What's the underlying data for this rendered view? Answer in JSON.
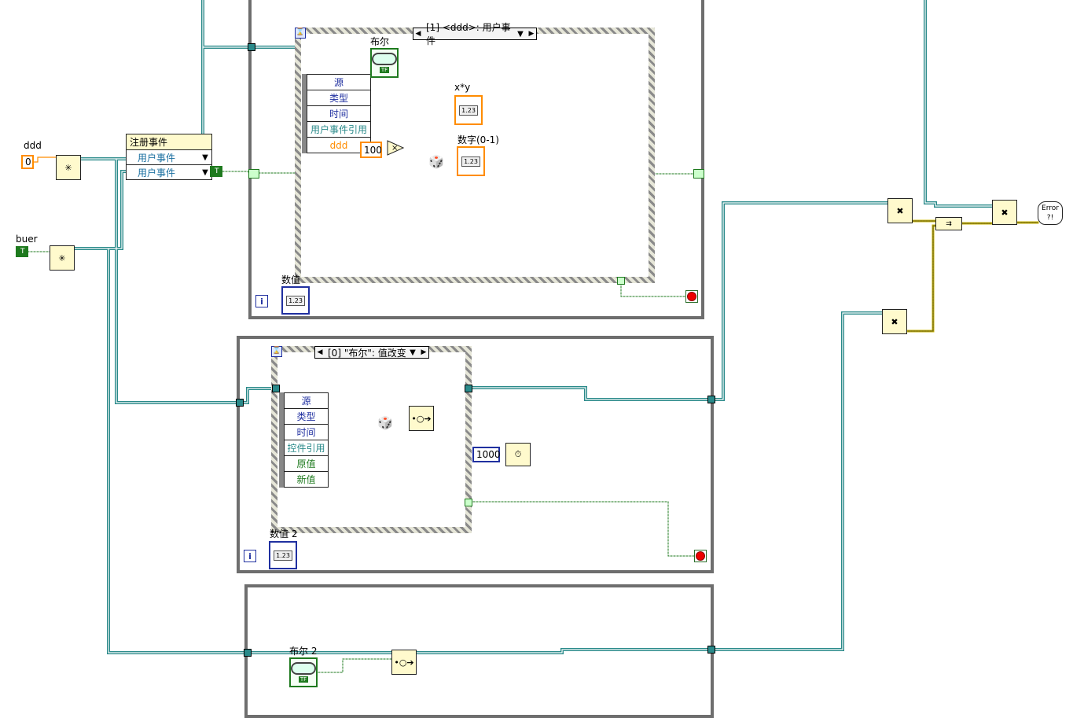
{
  "labels": {
    "ddd": "ddd",
    "buer": "buer",
    "bool": "布尔",
    "xy": "x*y",
    "num01": "数字(0-1)",
    "numeric": "数值",
    "numeric2": "数值 2",
    "bool2": "布尔 2"
  },
  "constants": {
    "ddd_value": "0",
    "buer_value": "T",
    "true_const": "T",
    "hundred": "100",
    "thousand": "1000",
    "iter": "i",
    "num_display": "1.23",
    "num_type_i32": "I32",
    "num_type_dbl": "DBL",
    "tf": "TF",
    "error_icon": "Error ?!",
    "multiply": "×"
  },
  "register": {
    "title": "注册事件",
    "items": [
      "用户事件",
      "用户事件"
    ]
  },
  "event1": {
    "selector": "[1] <ddd>: 用户事件",
    "data": [
      "源",
      "类型",
      "时间",
      "用户事件引用",
      "ddd"
    ]
  },
  "event2": {
    "selector": "[0] \"布尔\": 值改变",
    "data": [
      "源",
      "类型",
      "时间",
      "控件引用",
      "原值",
      "新值"
    ]
  },
  "colors": {
    "wire_refnum": "#2a8a8a",
    "wire_bool": "#1e7a1e",
    "wire_num": "#ff8c00",
    "wire_error": "#c8b400",
    "loop_border": "#6e6e6e",
    "blue": "#2030a0"
  }
}
